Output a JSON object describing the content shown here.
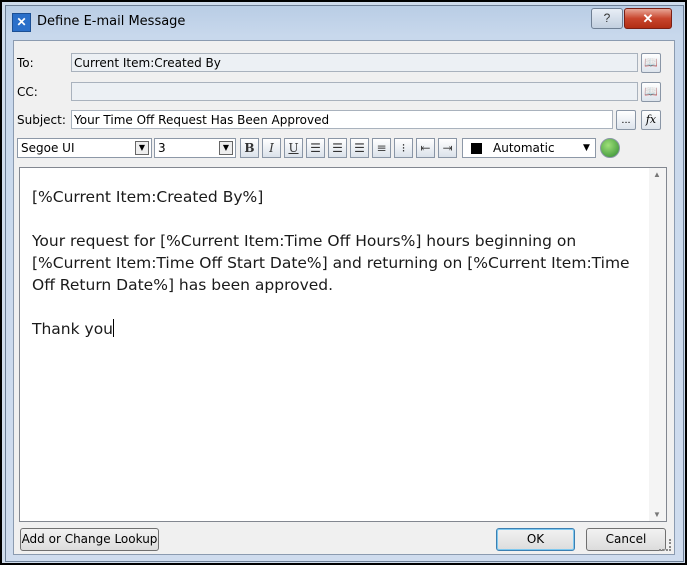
{
  "window": {
    "title": "Define E-mail Message",
    "help_glyph": "?",
    "close_glyph": "✕"
  },
  "form": {
    "to_label": "To:",
    "to_value": "Current Item:Created By",
    "cc_label": "CC:",
    "cc_value": "",
    "subject_label": "Subject:",
    "subject_value": "Your Time Off Request Has Been Approved",
    "ellipsis_label": "...",
    "fx_label": "fx"
  },
  "toolbar": {
    "font_name": "Segoe UI",
    "font_size": "3",
    "bold": "B",
    "italic": "I",
    "underline": "U",
    "color_label": "Automatic",
    "color_swatch": "#000000"
  },
  "body": {
    "line1": "[%Current Item:Created By%]",
    "line2": "Your request for [%Current Item:Time Off Hours%] hours beginning on [%Current Item:Time Off Start Date%] and returning on [%Current Item:Time Off Return Date%] has been approved.",
    "line3": "Thank you"
  },
  "buttons": {
    "lookup": "Add or Change Lookup",
    "ok": "OK",
    "cancel": "Cancel"
  },
  "icons": {
    "address_book": "address-book-icon",
    "color_picker": "color-picker-icon",
    "app": "sharepoint-designer-icon"
  }
}
